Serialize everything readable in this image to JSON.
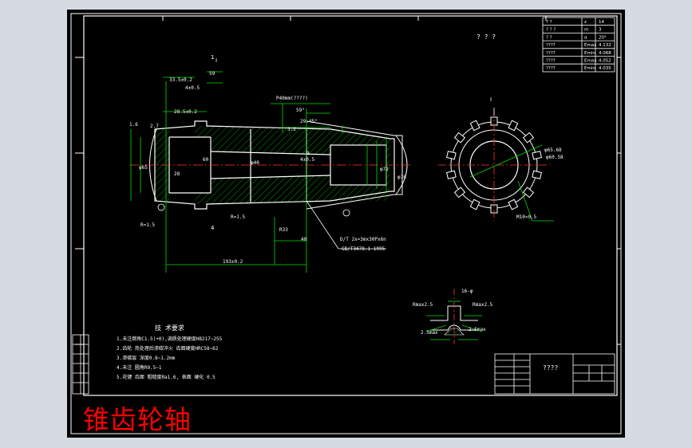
{
  "caption": "锥齿轮轴",
  "drawing_title": "? ? ?",
  "section_label": "I",
  "section_arrow_label": "1",
  "section_arrow_label2": "4",
  "dims": {
    "d_335": "33.5±0.2",
    "d_59": "59",
    "d_4": "4±0.5",
    "d_285": "28.5±0.2",
    "d_275": "2.7",
    "d_p40": "P40mm(????)",
    "d_592": "59°",
    "d_2945": "29.45°",
    "d_32": "3.2",
    "d_9": "9",
    "d_4b": "4±0.5",
    "d_28": "28",
    "d_40": "40",
    "d_193": "193±0.2",
    "d_r15": "R=1.5",
    "d_r16": "R=1.5",
    "d_r33": "R33",
    "d_16": "1.6",
    "d_60": "60",
    "d_spline": "D/T 2x=3mx30Px6n",
    "d_gb": "GB/T3478.1-1995",
    "d_65": "φ65",
    "d_40b": "φ40",
    "d_72": "φ72",
    "d_76": "φ76",
    "d_phi_big": "φ65.68",
    "d_phi_small": "φ60.58",
    "d_m10": "M10×0.5",
    "d_rmax1": "Rmax2.5",
    "d_rmax2": "Rmax2.5",
    "d_25a": "2.5max",
    "d_25b": "2.5max",
    "d_16b": "16-φ"
  },
  "notes": {
    "heading": "技 术要求",
    "lines": [
      "1.未注倒角C1.5(+0),调质处理硬度HB217~255",
      "2.齿轮 热处理后渗碳淬火 齿面硬度HRC58~62",
      "3.渗碳层 深度0.8~1.2mm",
      "4.未注 圆角R0.5~1",
      "5.花键 齿面 粗糙度Ra1.6, 表面 硬化 0.5"
    ]
  },
  "rev_table": [
    [
      "? ?",
      "z",
      "14"
    ],
    [
      "? ? ?",
      "m",
      "3"
    ],
    [
      "? ?",
      "α",
      "20°"
    ],
    [
      "????",
      "Emax",
      "4.132"
    ],
    [
      "????",
      "Emin",
      "4.068"
    ],
    [
      "????",
      "Emax",
      "4.052"
    ],
    [
      "????",
      "Emin",
      "4.035"
    ]
  ],
  "title_block": {
    "name": "????",
    "rows": [
      "",
      "",
      "",
      "",
      "",
      ""
    ]
  }
}
